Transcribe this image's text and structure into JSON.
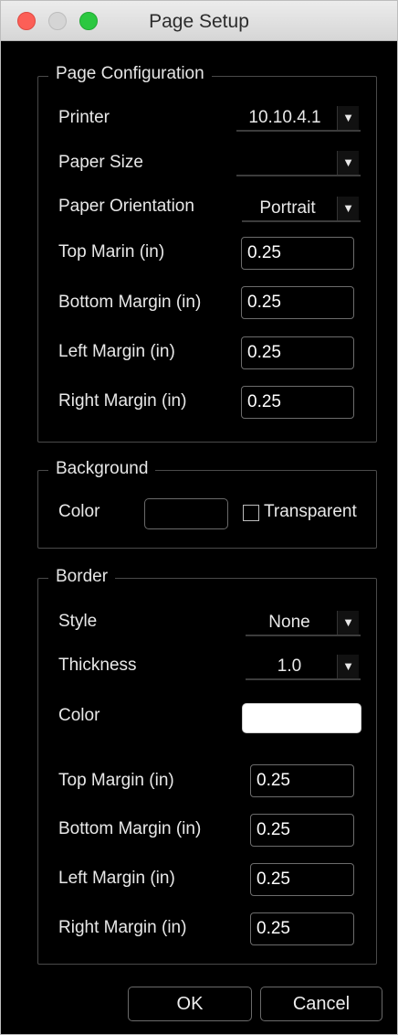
{
  "window": {
    "title": "Page Setup"
  },
  "page_configuration": {
    "legend": "Page Configuration",
    "printer_label": "Printer",
    "printer_value": "10.10.4.1",
    "paper_size_label": "Paper Size",
    "paper_size_value": "",
    "orientation_label": "Paper Orientation",
    "orientation_value": "Portrait",
    "top_margin_label": "Top Marin (in)",
    "top_margin_value": "0.25",
    "bottom_margin_label": "Bottom Margin (in)",
    "bottom_margin_value": "0.25",
    "left_margin_label": "Left Margin (in)",
    "left_margin_value": "0.25",
    "right_margin_label": "Right Margin (in)",
    "right_margin_value": "0.25"
  },
  "background": {
    "legend": "Background",
    "color_label": "Color",
    "color_value": "#000000",
    "transparent_label": "Transparent",
    "transparent_checked": false
  },
  "border": {
    "legend": "Border",
    "style_label": "Style",
    "style_value": "None",
    "thickness_label": "Thickness",
    "thickness_value": "1.0",
    "color_label": "Color",
    "color_value": "#ffffff",
    "top_margin_label": "Top Margin (in)",
    "top_margin_value": "0.25",
    "bottom_margin_label": "Bottom Margin (in)",
    "bottom_margin_value": "0.25",
    "left_margin_label": "Left Margin (in)",
    "left_margin_value": "0.25",
    "right_margin_label": "Right Margin (in)",
    "right_margin_value": "0.25"
  },
  "buttons": {
    "ok": "OK",
    "cancel": "Cancel"
  },
  "icons": {
    "close": "close-icon",
    "minimize": "minimize-icon",
    "zoom": "zoom-icon",
    "dropdown": "chevron-down-icon"
  }
}
